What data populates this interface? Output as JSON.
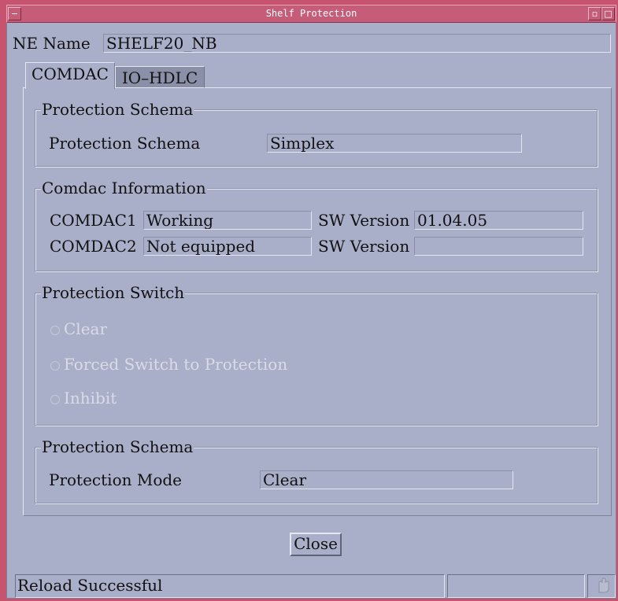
{
  "window": {
    "title": "Shelf Protection",
    "menu_glyph": "−",
    "max_glyph": "□",
    "min_glyph": "▫"
  },
  "ne": {
    "label": "NE Name",
    "value": "SHELF20_NB"
  },
  "tabs": [
    {
      "label": "COMDAC",
      "active": true
    },
    {
      "label": "IO–HDLC",
      "active": false
    }
  ],
  "protection_schema": {
    "title": "Protection Schema",
    "label": "Protection Schema",
    "value": "Simplex"
  },
  "comdac_info": {
    "title": "Comdac Information",
    "rows": [
      {
        "name": "COMDAC1",
        "status": "Working",
        "sw_label": "SW Version",
        "sw_value": "01.04.05"
      },
      {
        "name": "COMDAC2",
        "status": "Not equipped",
        "sw_label": "SW Version",
        "sw_value": ""
      }
    ]
  },
  "protection_switch": {
    "title": "Protection Switch",
    "options": [
      "Clear",
      "Forced Switch to Protection",
      "Inhibit"
    ],
    "enabled": false
  },
  "protection_mode": {
    "title": "Protection Schema",
    "label": "Protection Mode",
    "value": "Clear"
  },
  "close_label": "Close",
  "status_bar": {
    "message": "Reload Successful",
    "secondary": ""
  },
  "colors": {
    "window_border": "#c7546f",
    "panel_bg": "#a9afc8",
    "inactive_tab": "#8a90a7",
    "disabled_text": "#d9dce8"
  }
}
